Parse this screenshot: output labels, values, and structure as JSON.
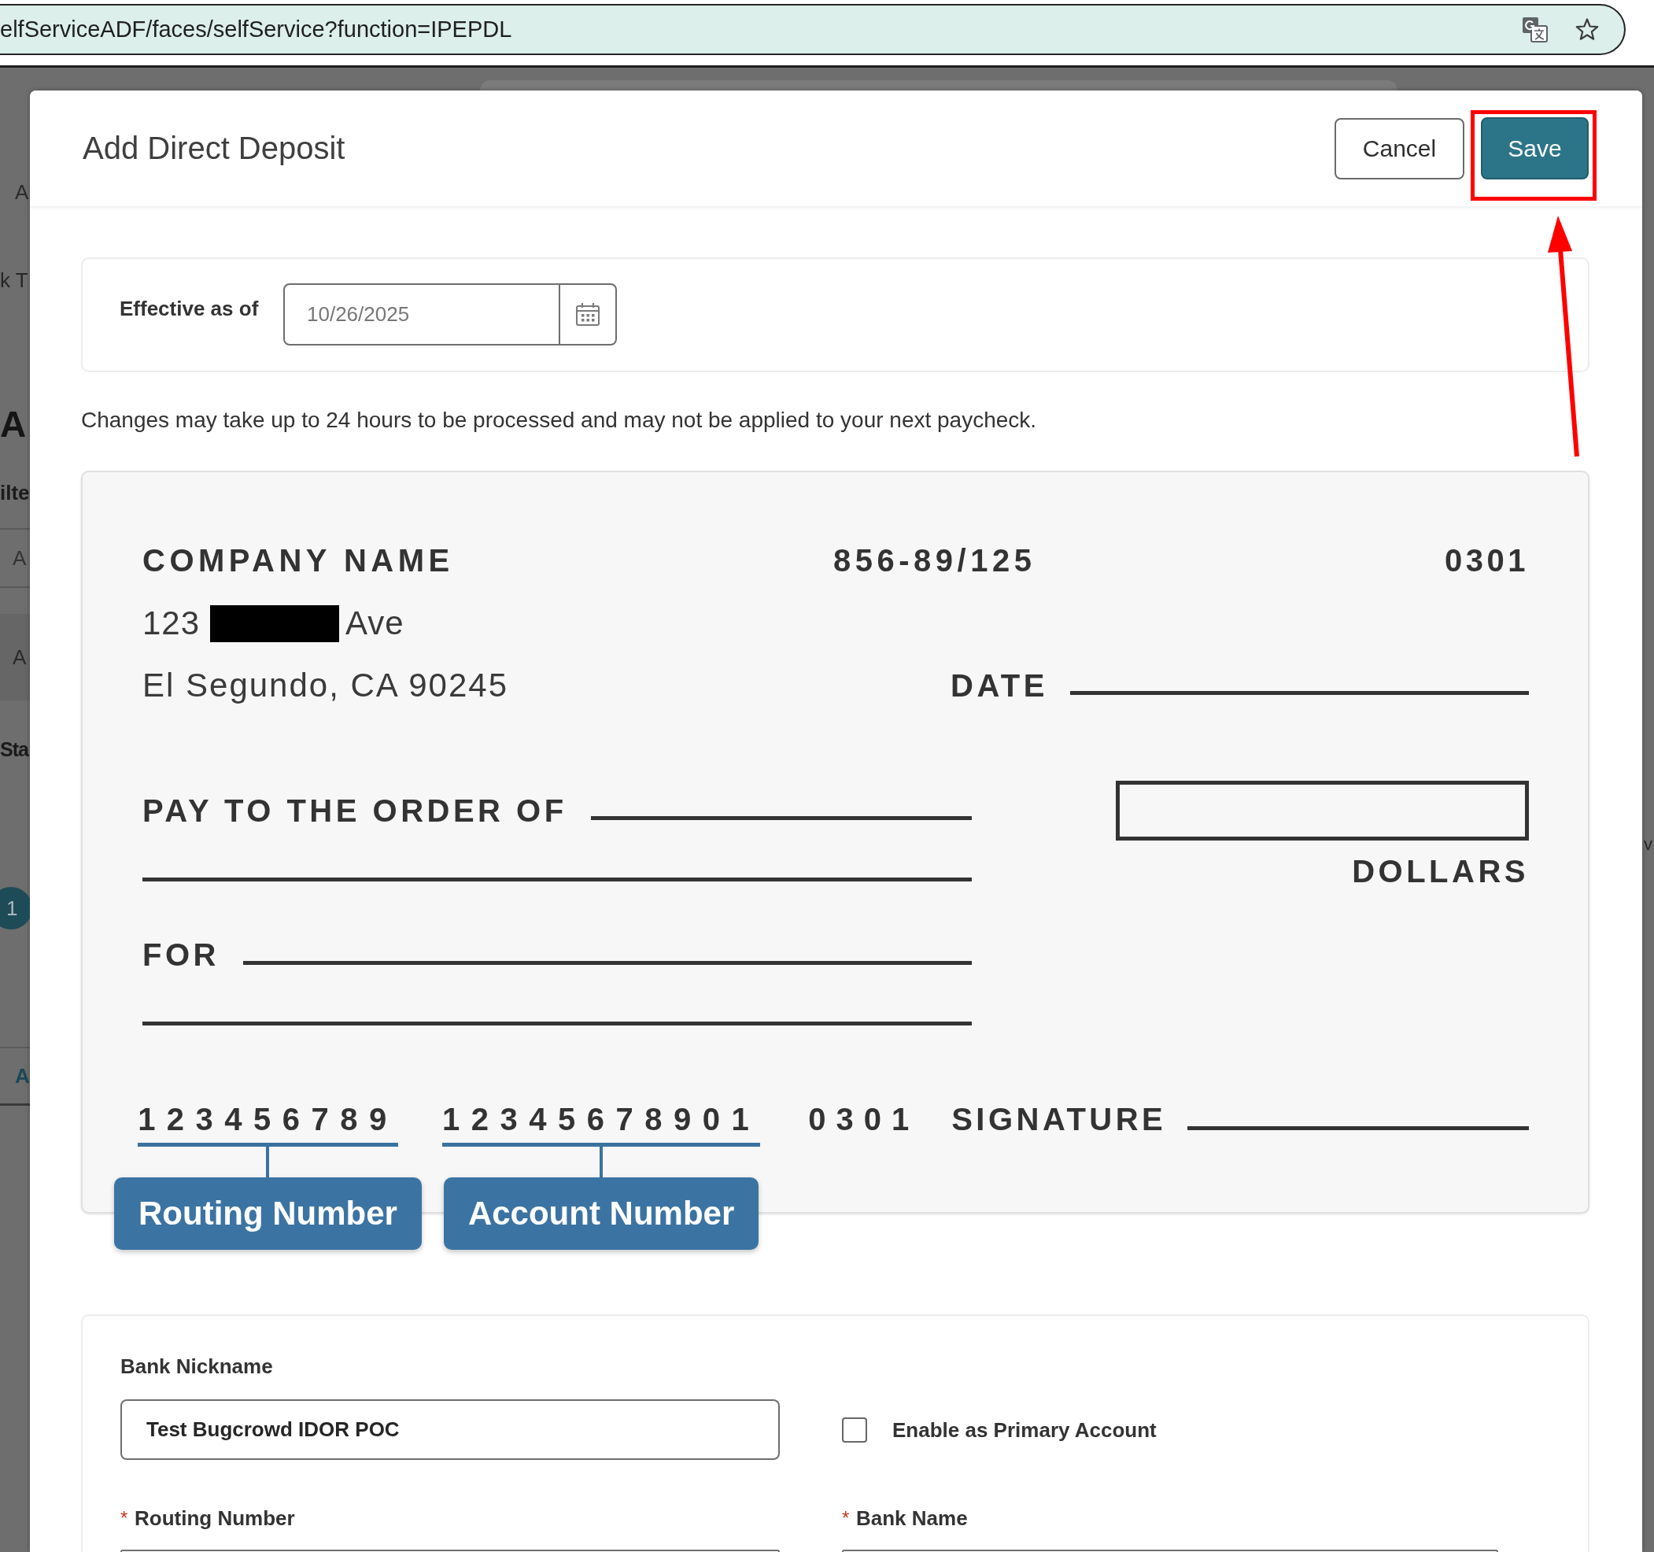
{
  "browser": {
    "url": "elfServiceADF/faces/selfService?function=IPEPDL"
  },
  "background_page": {
    "left_edge": [
      {
        "kind": "nav",
        "text": "A"
      },
      {
        "kind": "plain",
        "text": "k T"
      },
      {
        "kind": "heading",
        "text": "A"
      },
      {
        "kind": "label",
        "text": "ilte"
      },
      {
        "kind": "row",
        "text": "A"
      },
      {
        "kind": "band",
        "text": "A"
      },
      {
        "kind": "subheading",
        "text": "Sta"
      },
      {
        "kind": "badge",
        "text": "1"
      },
      {
        "kind": "tab",
        "text": "A"
      }
    ],
    "right_edge": [
      {
        "kind": "plain",
        "text": "v"
      }
    ]
  },
  "dialog": {
    "title": "Add Direct Deposit",
    "buttons": [
      {
        "label": "Cancel",
        "kind": "secondary",
        "highlighted": false
      },
      {
        "label": "Save",
        "kind": "primary",
        "highlighted": true
      }
    ]
  },
  "effective_date": {
    "label": "Effective as of",
    "value": "10/26/2025"
  },
  "notice": "Changes may take up to 24 hours to be processed and may not be applied to your next paycheck.",
  "check": {
    "company_name": "COMPANY NAME",
    "fraction_code": "856-89/125",
    "check_number": "0301",
    "address_number": "123",
    "address_redacted": true,
    "address_street": "Ave",
    "city_state_zip": "El Segundo, CA 90245",
    "date_label": "DATE",
    "payee_label": "PAY TO THE ORDER OF",
    "dollars_label": "DOLLARS",
    "memo_label": "FOR",
    "micr_fields": [
      {
        "digits": "123456789",
        "callout": "Routing Number"
      },
      {
        "digits": "12345678901",
        "callout": "Account Number"
      }
    ],
    "micr_check_number": "0301",
    "signature_label": "SIGNATURE"
  },
  "bank_form": {
    "nickname": {
      "label": "Bank Nickname",
      "value": "Test Bugcrowd IDOR POC"
    },
    "primary_account": {
      "label": "Enable as Primary Account",
      "checked": false
    },
    "fields": [
      {
        "required_mark": "*",
        "label": "Routing Number"
      },
      {
        "required_mark": "*",
        "label": "Bank Name"
      }
    ]
  }
}
